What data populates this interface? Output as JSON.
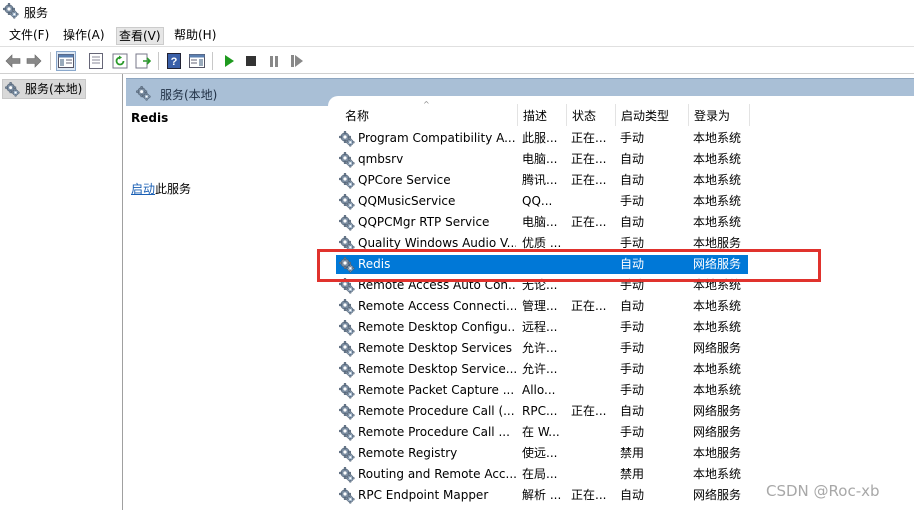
{
  "window": {
    "title": "服务",
    "icon": "services-gear-icon"
  },
  "menubar": {
    "items": [
      "文件(F)",
      "操作(A)",
      "查看(V)",
      "帮助(H)"
    ],
    "active_index": 2
  },
  "toolbar": {
    "buttons": [
      "back-arrow-icon",
      "forward-arrow-icon",
      "show-console-tree-icon",
      "properties-icon",
      "refresh-icon",
      "export-list-icon",
      "help-icon",
      "show-action-pane-icon",
      "start-service-icon",
      "stop-service-icon",
      "pause-service-icon",
      "resume-service-icon"
    ]
  },
  "tree": {
    "root_label": "服务(本地)"
  },
  "panel": {
    "header_title": "服务(本地)"
  },
  "description": {
    "service_name": "Redis",
    "action_link": "启动",
    "action_suffix": "此服务"
  },
  "columns": {
    "name": "名称",
    "description": "描述",
    "status": "状态",
    "startup_type": "启动类型",
    "logon_as": "登录为"
  },
  "services": [
    {
      "name": "Program Compatibility A...",
      "description": "此服...",
      "status": "正在...",
      "startup": "手动",
      "logon": "本地系统"
    },
    {
      "name": "qmbsrv",
      "description": "电脑...",
      "status": "正在...",
      "startup": "自动",
      "logon": "本地系统"
    },
    {
      "name": "QPCore Service",
      "description": "腾讯...",
      "status": "正在...",
      "startup": "自动",
      "logon": "本地系统"
    },
    {
      "name": "QQMusicService",
      "description": "QQ...",
      "status": "",
      "startup": "手动",
      "logon": "本地系统"
    },
    {
      "name": "QQPCMgr RTP Service",
      "description": "电脑...",
      "status": "正在...",
      "startup": "自动",
      "logon": "本地系统"
    },
    {
      "name": "Quality Windows Audio V...",
      "description": "优质 ...",
      "status": "",
      "startup": "手动",
      "logon": "本地服务"
    },
    {
      "name": "Redis",
      "description": "",
      "status": "",
      "startup": "自动",
      "logon": "网络服务"
    },
    {
      "name": "Remote Access Auto Con...",
      "description": "无论...",
      "status": "",
      "startup": "手动",
      "logon": "本地系统"
    },
    {
      "name": "Remote Access Connecti...",
      "description": "管理...",
      "status": "正在...",
      "startup": "自动",
      "logon": "本地系统"
    },
    {
      "name": "Remote Desktop Configu...",
      "description": "远程...",
      "status": "",
      "startup": "手动",
      "logon": "本地系统"
    },
    {
      "name": "Remote Desktop Services",
      "description": "允许...",
      "status": "",
      "startup": "手动",
      "logon": "网络服务"
    },
    {
      "name": "Remote Desktop Service...",
      "description": "允许...",
      "status": "",
      "startup": "手动",
      "logon": "本地系统"
    },
    {
      "name": "Remote Packet Capture ...",
      "description": "Allo...",
      "status": "",
      "startup": "手动",
      "logon": "本地系统"
    },
    {
      "name": "Remote Procedure Call (...",
      "description": "RPC...",
      "status": "正在...",
      "startup": "自动",
      "logon": "网络服务"
    },
    {
      "name": "Remote Procedure Call ...",
      "description": "在 W...",
      "status": "",
      "startup": "手动",
      "logon": "网络服务"
    },
    {
      "name": "Remote Registry",
      "description": "使远...",
      "status": "",
      "startup": "禁用",
      "logon": "本地服务"
    },
    {
      "name": "Routing and Remote Acc...",
      "description": "在局...",
      "status": "",
      "startup": "禁用",
      "logon": "本地系统"
    },
    {
      "name": "RPC Endpoint Mapper",
      "description": "解析 ...",
      "status": "正在...",
      "startup": "自动",
      "logon": "网络服务"
    }
  ],
  "selected_index": 6,
  "colors": {
    "selection": "#0078d7",
    "highlight_box": "#e0322d",
    "header_bg": "#a9bfd6",
    "link": "#1a5fb4"
  },
  "watermark": "CSDN @Roc-xb"
}
